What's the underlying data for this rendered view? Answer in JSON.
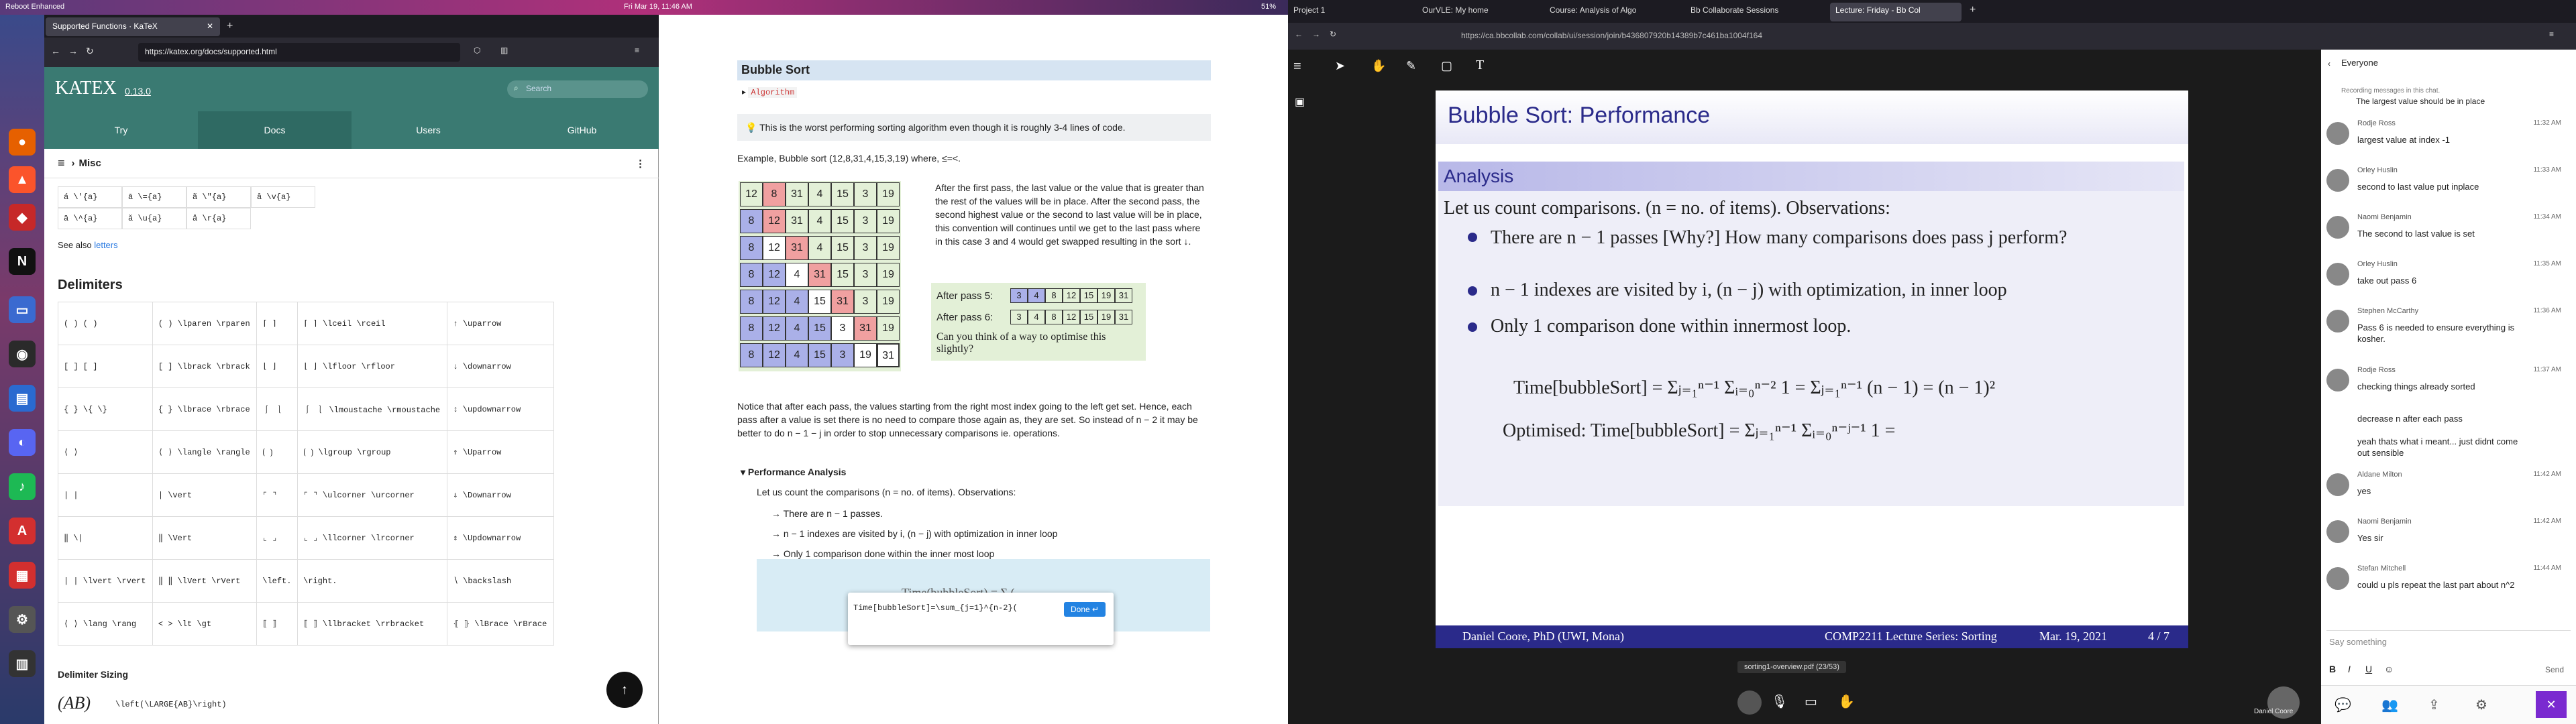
{
  "system": {
    "clock": "Fri Mar 19, 11:46 AM",
    "battery": "51%",
    "notification": "Reboot Enhanced"
  },
  "left_browser": {
    "tab_title": "Supported Functions · KaTeX",
    "url": "https://katex.org/docs/supported.html",
    "search_placeholder": "Search",
    "logo": "KATEX",
    "version": "0.13.0",
    "nav_tabs": [
      "Try",
      "Docs",
      "Users",
      "GitHub"
    ],
    "section_bar": "Misc",
    "accents_rows": [
      [
        "á \\'{a}",
        "ā \\={a}",
        "ã \\\"{a}",
        "ȃ \\v{a}"
      ],
      [
        "ā \\^{a}",
        "ă \\u{a}",
        "å \\r{a}"
      ]
    ],
    "see_also": "See also",
    "see_also_link": "letters",
    "heading": "Delimiters",
    "delimiters": [
      [
        "( )  ( )",
        "( ) \\lparen \\rparen",
        "⌈ ⌉",
        "⌈ ⌉ \\lceil \\rceil",
        "↑ \\uparrow"
      ],
      [
        "[ ]  [ ]",
        "[ ] \\lbrack \\rbrack",
        "⌊ ⌋",
        "⌊ ⌋ \\lfloor \\rfloor",
        "↓ \\downarrow"
      ],
      [
        "{ }  \\{ \\}",
        "{ } \\lbrace \\rbrace",
        "⎰ ⎱",
        "⎰ ⎱ \\lmoustache \\rmoustache",
        "↕ \\updownarrow"
      ],
      [
        "⟨ ⟩",
        "⟨ ⟩ \\langle \\rangle",
        "⟮ ⟯",
        "⟮ ⟯ \\lgroup \\rgroup",
        "⇑ \\Uparrow"
      ],
      [
        "| |",
        "| \\vert",
        "⌜ ⌝",
        "⌜ ⌝ \\ulcorner \\urcorner",
        "⇓ \\Downarrow"
      ],
      [
        "‖ \\|",
        "‖ \\Vert",
        "⌞ ⌟",
        "⌞ ⌟ \\llcorner \\lrcorner",
        "⇕ \\Updownarrow"
      ],
      [
        "| | \\lvert \\rvert",
        "‖ ‖ \\lVert \\rVert",
        "\\left.",
        "\\right.",
        "∖ \\backslash"
      ],
      [
        "⟨ ⟩ \\lang \\rang",
        "< > \\lt \\gt",
        "⟦ ⟧",
        "⟦ ⟧ \\llbracket \\rrbracket",
        "⦃ ⦄ \\lBrace \\rBrace"
      ]
    ],
    "delim_sizing": "Delimiter Sizing",
    "delim_sizing_example": "(AB)",
    "delim_sizing_code": "\\left(\\LARGE{AB}\\right)"
  },
  "middle_page": {
    "title": "Bubble Sort",
    "algorithm_label": "Algorithm",
    "note": "This is the worst performing sorting algorithm even though it is roughly 3-4 lines of code.",
    "example": "Example, Bubble sort (12,8,31,4,15,3,19) where, ≤=<.",
    "explain": "After the first pass, the last value or the value that is greater than the rest of the values will be in place. After the second pass, the second highest value or the second to last value will be in place, this convention will continues until we get to the last pass where in this case 3 and 4 would get swapped resulting in the sort ↓.",
    "passes": [
      [
        "12",
        "8",
        "31",
        "4",
        "15",
        "3",
        "19"
      ],
      [
        "8",
        "12",
        "31",
        "4",
        "15",
        "3",
        "19"
      ],
      [
        "8",
        "12",
        "31",
        "4",
        "15",
        "3",
        "19"
      ],
      [
        "8",
        "12",
        "4",
        "31",
        "15",
        "3",
        "19"
      ],
      [
        "8",
        "12",
        "4",
        "15",
        "31",
        "3",
        "19"
      ],
      [
        "8",
        "12",
        "4",
        "15",
        "3",
        "31",
        "19"
      ],
      [
        "8",
        "12",
        "4",
        "15",
        "3",
        "19",
        "31"
      ]
    ],
    "after5_label": "After pass 5:",
    "after5": [
      "3",
      "4",
      "8",
      "12",
      "15",
      "19",
      "31"
    ],
    "after6_label": "After pass 6:",
    "after6": [
      "3",
      "4",
      "8",
      "12",
      "15",
      "19",
      "31"
    ],
    "question": "Can you think of a way to optimise this slightly?",
    "notice": "Notice that after each pass, the values starting from the right most index going to the left get set. Hence, each pass after a value is set there is no need to compare those again as, they are set. So instead of n − 2 it may be better to do n − 1 − j in order to stop unnecessary comparisons ie. operations.",
    "perf_heading": "Performance Analysis",
    "perf_intro": "Let us count the comparisons (n = no. of items). Observations:",
    "perf_items": [
      "→ There are n − 1 passes.",
      "→ n − 1 indexes are visited by i, (n − j) with optimization in inner loop",
      "→ Only 1 comparison done within the inner most loop"
    ],
    "editor_text": "Time[bubbleSort]=\\sum_{j=1}^{n-2}(",
    "done_label": "Done ↵",
    "formula_preview": "Time(bubbleSort) = Σ ("
  },
  "right_browser": {
    "tabs": [
      "Project 1",
      "OurVLE: My home",
      "Course: Analysis of Algo",
      "Bb Collaborate Sessions",
      "Lecture: Friday - Bb Col"
    ],
    "url": "https://ca.bbcollab.com/collab/ui/session/join/b436807920b14389b7c461ba1004f164",
    "slide_title": "Bubble Sort: Performance",
    "analysis_heading": "Analysis",
    "slide_intro": "Let us count comparisons. (n = no. of items). Observations:",
    "bullets": [
      "There are n − 1 passes [Why?] How many comparisons does pass j perform?",
      "n − 1 indexes are visited by i, (n − j) with optimization, in inner loop",
      "Only 1 comparison done within innermost loop."
    ],
    "formula1": "Time[bubbleSort] = Σⱼ₌₁ⁿ⁻¹ Σᵢ₌₀ⁿ⁻² 1 = Σⱼ₌₁ⁿ⁻¹ (n − 1) = (n − 1)²",
    "formula2": "Optimised: Time[bubbleSort] = Σⱼ₌₁ⁿ⁻¹ Σᵢ₌₀ⁿ⁻ʲ⁻¹ 1 =",
    "footer_author": "Daniel Coore, PhD (UWI, Mona)",
    "footer_series": "COMP2211 Lecture Series: Sorting",
    "footer_date": "Mar. 19, 2021",
    "footer_page": "4 / 7",
    "file_label": "sorting1-overview.pdf (23/53)",
    "presenter": "Daniel Coore",
    "chat_title": "Everyone",
    "chat_note": "Recording messages in this chat.",
    "chat_first": "The largest value should be in place",
    "messages": [
      {
        "name": "Rodje Ross",
        "time": "11:32 AM",
        "text": "largest value at index -1"
      },
      {
        "name": "Orley Huslin",
        "time": "11:33 AM",
        "text": "second to last value put inplace"
      },
      {
        "name": "Naomi Benjamin",
        "time": "11:34 AM",
        "text": "The second to last value is set"
      },
      {
        "name": "Orley Huslin",
        "time": "11:35 AM",
        "text": "take out pass 6"
      },
      {
        "name": "Stephen McCarthy",
        "time": "11:36 AM",
        "text": "Pass 6 is needed to ensure everything is kosher."
      },
      {
        "name": "Rodje Ross",
        "time": "11:37 AM",
        "text": "checking things already sorted"
      },
      {
        "name": "",
        "time": "",
        "text": "decrease n after each pass"
      },
      {
        "name": "",
        "time": "",
        "text": "yeah thats what i meant... just didnt come out sensible"
      },
      {
        "name": "Aldane Milton",
        "time": "11:42 AM",
        "text": "yes"
      },
      {
        "name": "Naomi Benjamin",
        "time": "11:42 AM",
        "text": "Yes sir"
      },
      {
        "name": "Stefan Mitchell",
        "time": "11:44 AM",
        "text": "could u pls repeat the last part about n^2"
      }
    ],
    "chat_input_placeholder": "Say something",
    "send_label": "Send"
  }
}
